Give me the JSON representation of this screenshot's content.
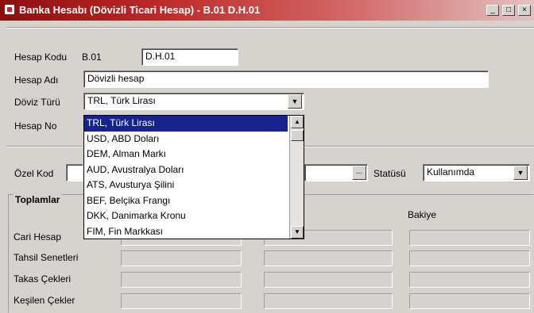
{
  "window": {
    "title": "Banka Hesabı (Dövizli Ticari Hesap) - B.01 D.H.01",
    "min_glyph": "_",
    "max_glyph": "□",
    "close_glyph": "×"
  },
  "form": {
    "hesap_kodu_label": "Hesap Kodu",
    "hesap_kodu_prefix": "B.01",
    "hesap_kodu_value": "D.H.01",
    "hesap_adi_label": "Hesap Adı",
    "hesap_adi_value": "Dövizli hesap",
    "doviz_turu_label": "Döviz Türü",
    "doviz_turu_value": "TRL, Türk Lirası",
    "hesap_no_label": "Hesap No",
    "ozel_kod_label": "Özel Kod",
    "statusu_label": "Statüsü",
    "statusu_value": "Kullanımda",
    "ellipsis": "..."
  },
  "currency_dropdown": {
    "options": [
      "TRL, Türk Lirası",
      "USD, ABD Doları",
      "DEM, Alman Markı",
      "AUD, Avustralya Doları",
      "ATS, Avusturya Şilini",
      "BEF, Belçika Frangı",
      "DKK, Danimarka Kronu",
      "FIM, Fin Markkası"
    ],
    "selected_index": 0
  },
  "totals": {
    "group_title": "Toplamlar",
    "col_bakiye": "Bakiye",
    "rows": [
      "Cari Hesap",
      "Tahsil Senetleri",
      "Takas Çekleri",
      "Keşilen Çekler"
    ]
  },
  "icons": {
    "dropdown_arrow": "▼",
    "scroll_up": "▲",
    "scroll_down": "▼"
  }
}
